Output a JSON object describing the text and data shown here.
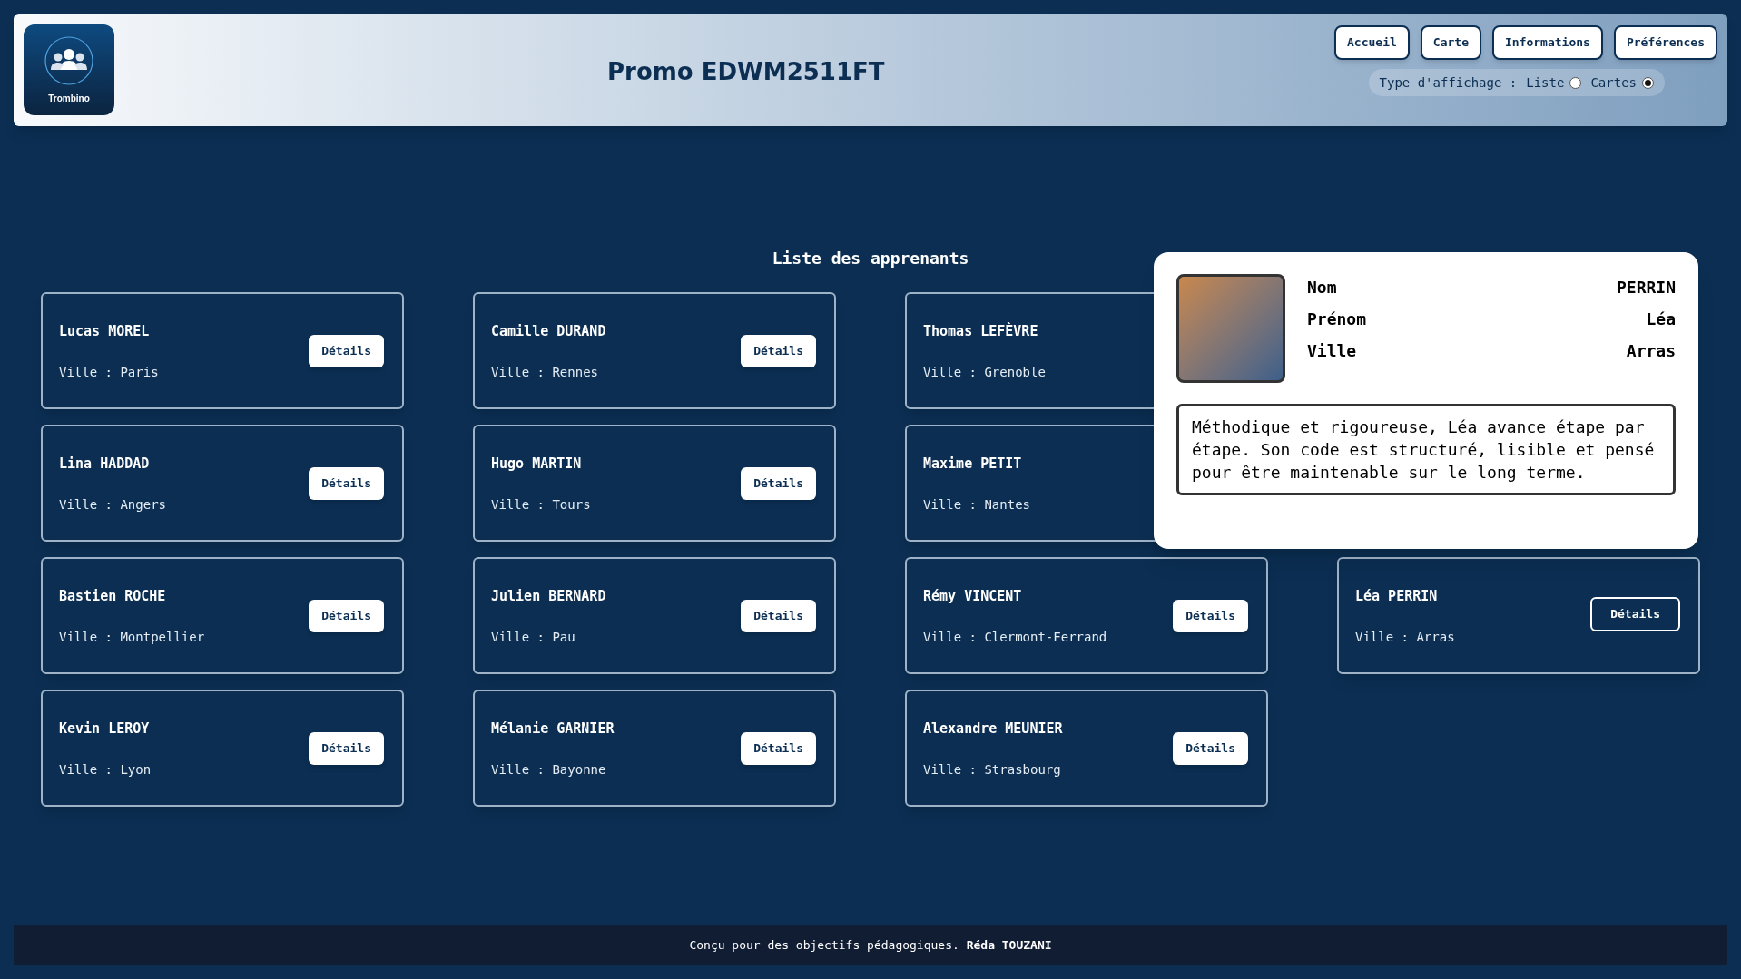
{
  "header": {
    "logo_label": "Trombino",
    "title": "Promo EDWM2511FT",
    "nav": [
      {
        "label": "Accueil"
      },
      {
        "label": "Carte"
      },
      {
        "label": "Informations"
      },
      {
        "label": "Préférences"
      }
    ],
    "display_type": {
      "label": "Type d'affichage :",
      "options": [
        {
          "label": "Liste",
          "selected": false
        },
        {
          "label": "Cartes",
          "selected": true
        }
      ]
    }
  },
  "list_title": "Liste des apprenants",
  "rows": [
    [
      {
        "name": "Lucas MOREL",
        "city": "Ville : Paris",
        "button": {
          "label": "Détails",
          "selected": false
        }
      },
      {
        "name": "Camille DURAND",
        "city": "Ville : Rennes",
        "button": {
          "label": "Détails",
          "selected": false
        }
      },
      {
        "name": "Thomas LEFÈVRE",
        "city": "Ville : Grenoble"
      }
    ],
    [
      {
        "name": "Lina HADDAD",
        "city": "Ville : Angers",
        "button": {
          "label": "Détails",
          "selected": false
        }
      },
      {
        "name": "Hugo MARTIN",
        "city": "Ville : Tours",
        "button": {
          "label": "Détails",
          "selected": false
        }
      },
      {
        "name": "Maxime PETIT",
        "city": "Ville : Nantes"
      }
    ],
    [
      {
        "name": "Bastien ROCHE",
        "city": "Ville : Montpellier",
        "button": {
          "label": "Détails",
          "selected": false
        }
      },
      {
        "name": "Julien BERNARD",
        "city": "Ville : Pau",
        "button": {
          "label": "Détails",
          "selected": false
        }
      },
      {
        "name": "Rémy VINCENT",
        "city": "Ville : Clermont-Ferrand",
        "button": {
          "label": "Détails",
          "selected": false
        }
      },
      {
        "name": "Léa PERRIN",
        "city": "Ville : Arras",
        "button": {
          "label": "Détails",
          "selected": true
        }
      }
    ],
    [
      {
        "name": "Kevin LEROY",
        "city": "Ville : Lyon",
        "button": {
          "label": "Détails",
          "selected": false
        }
      },
      {
        "name": "Mélanie GARNIER",
        "city": "Ville : Bayonne",
        "button": {
          "label": "Détails",
          "selected": false
        }
      },
      {
        "name": "Alexandre MEUNIER",
        "city": "Ville : Strasbourg",
        "button": {
          "label": "Détails",
          "selected": false
        }
      }
    ]
  ],
  "popup": {
    "fields": [
      {
        "label": "Nom",
        "value": "PERRIN"
      },
      {
        "label": "Prénom",
        "value": "Léa"
      },
      {
        "label": "Ville",
        "value": "Arras"
      }
    ],
    "description": "Méthodique et rigoureuse, Léa avance étape par étape. Son code est structuré, lisible et pensé pour être maintenable sur le long terme."
  },
  "footer": "Conçu pour des objectifs pédagogiques. **Réda TOUZANI**"
}
